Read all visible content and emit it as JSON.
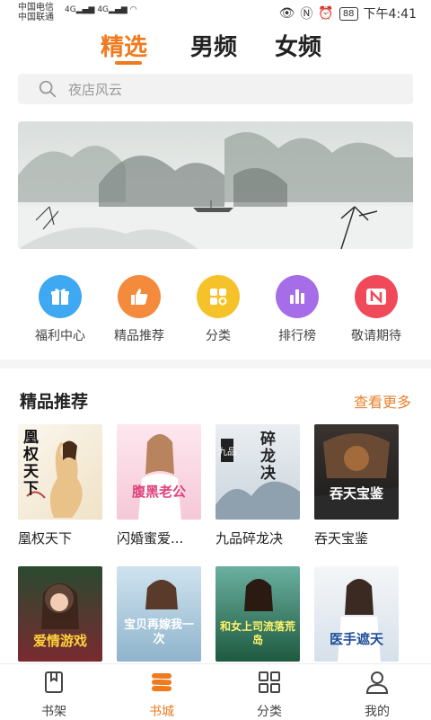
{
  "status_bar": {
    "carrier1": "中国电信",
    "carrier2": "中国联通",
    "net1": "4G",
    "net2": "4G",
    "battery": "88",
    "time": "下午4:41"
  },
  "tabs": [
    "精选",
    "男频",
    "女频"
  ],
  "search": {
    "placeholder": "夜店风云",
    "icon": "search-icon"
  },
  "quick_icons": [
    {
      "label": "福利中心",
      "icon": "gift-icon",
      "color": "#3fa8f2"
    },
    {
      "label": "精品推荐",
      "icon": "thumbs-up-icon",
      "color": "#f38a3c"
    },
    {
      "label": "分类",
      "icon": "grid-icon",
      "color": "#f6c22a"
    },
    {
      "label": "排行榜",
      "icon": "bar-chart-icon",
      "color": "#a56ee8"
    },
    {
      "label": "敬请期待",
      "icon": "n-badge-icon",
      "color": "#f04a5a"
    }
  ],
  "section": {
    "title": "精品推荐",
    "more": "查看更多"
  },
  "books": [
    {
      "title": "凰权天下",
      "cover_text": "凰权天下"
    },
    {
      "title": "闪婚蜜爱...",
      "cover_text": "腹黑老公"
    },
    {
      "title": "九品碎龙决",
      "cover_text": "碎龙决"
    },
    {
      "title": "吞天宝鉴",
      "cover_text": "吞天宝鉴"
    },
    {
      "title": "",
      "cover_text": "爱情游戏"
    },
    {
      "title": "",
      "cover_text": "宝贝再嫁我一次"
    },
    {
      "title": "",
      "cover_text": "和女上司流落荒岛"
    },
    {
      "title": "",
      "cover_text": "医手遮天"
    }
  ],
  "nav": [
    {
      "label": "书架",
      "icon": "bookshelf-icon"
    },
    {
      "label": "书城",
      "icon": "bookstore-icon"
    },
    {
      "label": "分类",
      "icon": "category-icon"
    },
    {
      "label": "我的",
      "icon": "profile-icon"
    }
  ]
}
